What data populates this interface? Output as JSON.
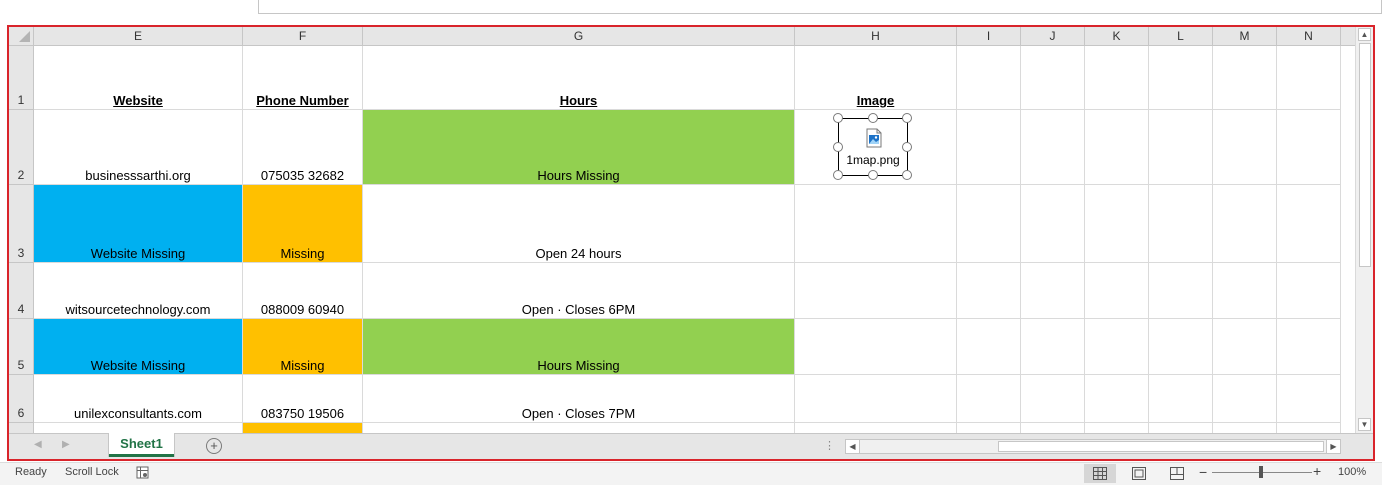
{
  "columns": [
    "E",
    "F",
    "G",
    "H",
    "I",
    "J",
    "K",
    "L",
    "M",
    "N"
  ],
  "rows": [
    "1",
    "2",
    "3",
    "4",
    "5",
    "6"
  ],
  "headers": {
    "website": "Website",
    "phone": "Phone Number",
    "hours": "Hours",
    "image": "Image"
  },
  "data_rows": [
    {
      "website": "businesssarthi.org",
      "phone": "075035 32682",
      "hours": "Hours Missing"
    },
    {
      "website": "Website Missing",
      "phone": "Missing",
      "hours": "Open 24 hours"
    },
    {
      "website": "witsourcetechnology.com",
      "phone": "088009 60940",
      "hours": "Open · Closes 6PM"
    },
    {
      "website": "Website Missing",
      "phone": "Missing",
      "hours": "Hours Missing"
    },
    {
      "website": "unilexconsultants.com",
      "phone": "083750 19506",
      "hours": "Open · Closes 7PM"
    }
  ],
  "image_object": {
    "filename": "1map.png",
    "icon": "image-file-icon"
  },
  "sheet_tabs": [
    "Sheet1"
  ],
  "status": {
    "ready": "Ready",
    "scroll_lock": "Scroll Lock",
    "zoom": "100%"
  },
  "colors": {
    "frame": "#d9242b",
    "blue_fill": "#00b0f0",
    "orange_fill": "#ffc000",
    "green_fill": "#92d050",
    "tab_accent": "#217346"
  }
}
